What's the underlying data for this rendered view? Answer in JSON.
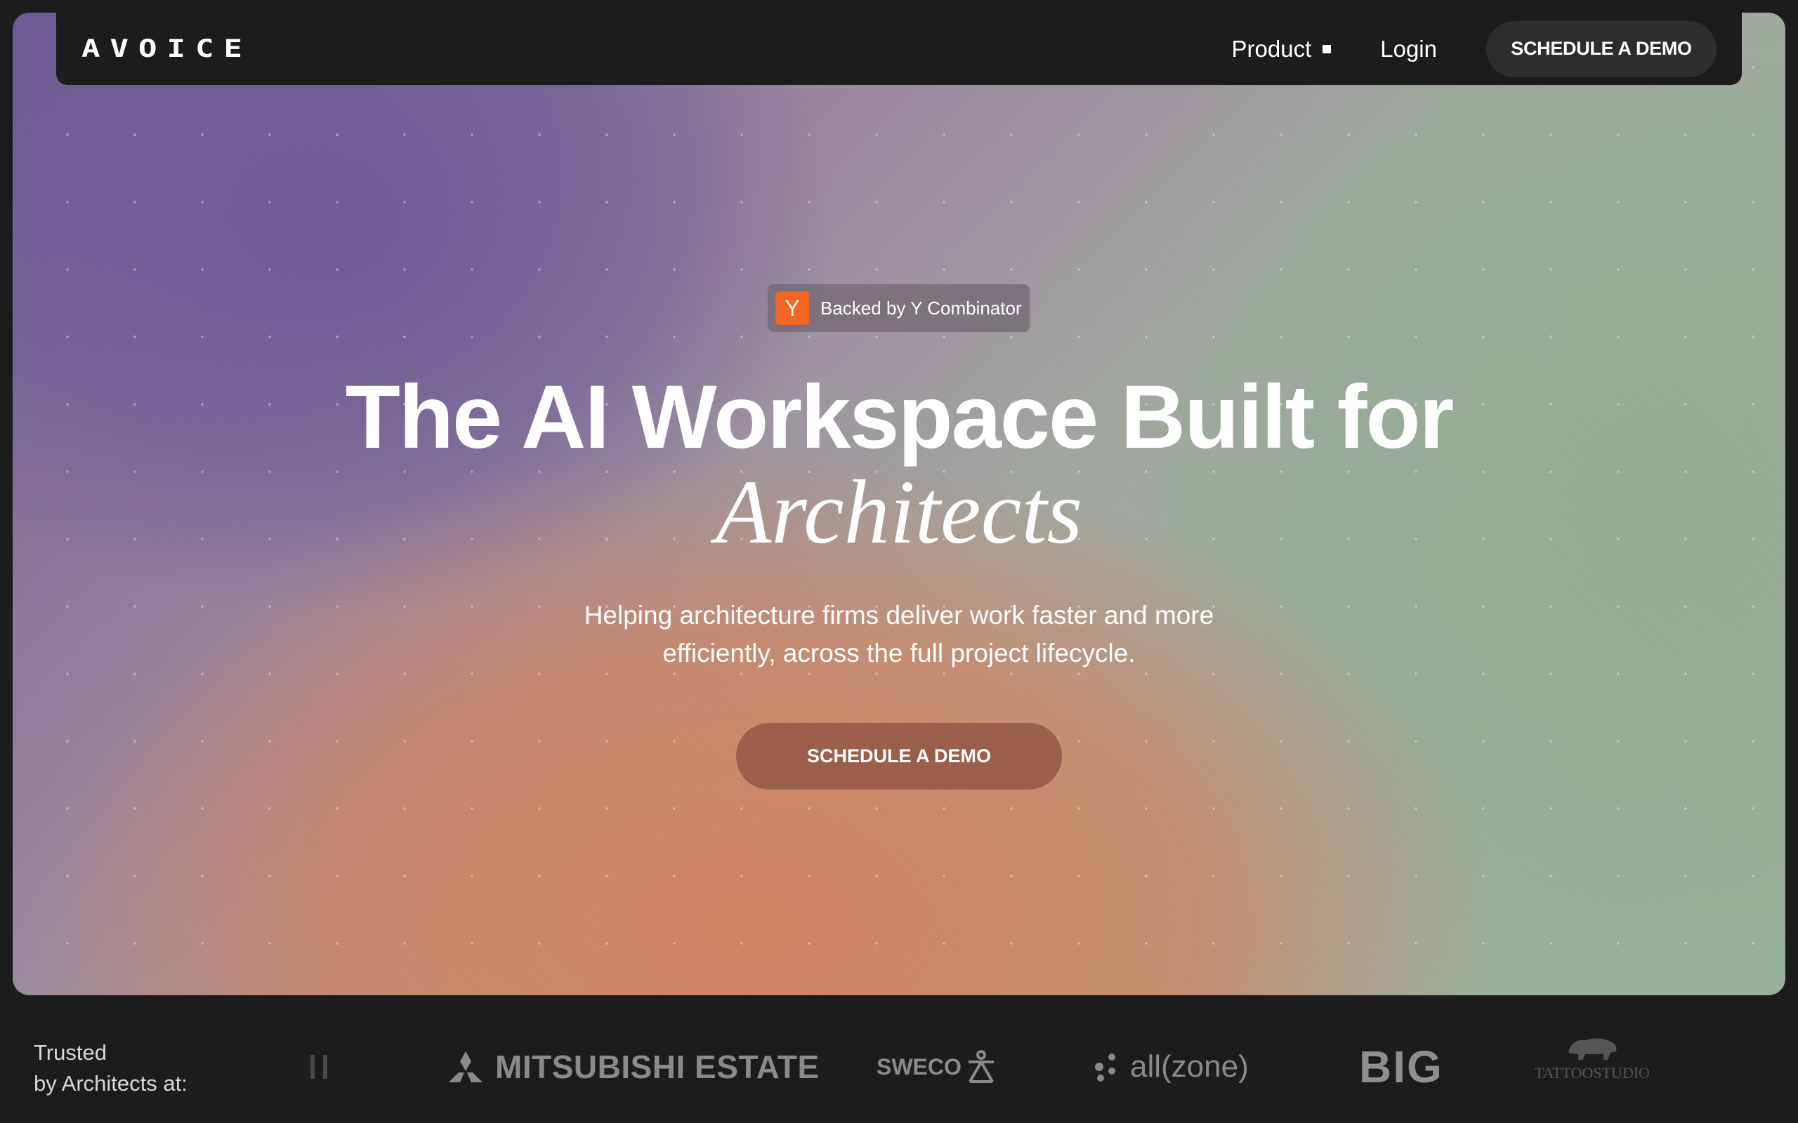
{
  "nav": {
    "logo": "AVOICE",
    "product_label": "Product",
    "login_label": "Login",
    "cta_label": "SCHEDULE A DEMO"
  },
  "hero": {
    "badge_letter": "Y",
    "badge_text": "Backed by Y Combinator",
    "headline": "The AI Workspace Built for",
    "headline_italic": "Architects",
    "subhead_line1": "Helping architecture firms deliver work faster and more",
    "subhead_line2": "efficiently, across the full project lifecycle.",
    "cta_label": "SCHEDULE A DEMO"
  },
  "trusted": {
    "line1": "Trusted",
    "line2": "by Architects at:",
    "logos": {
      "mitsubishi": "MITSUBISHI ESTATE",
      "sweco": "SWECO",
      "allzone": "all(zone)",
      "big": "BIG",
      "tattoo": "TATTOOSTUDIO"
    }
  },
  "colors": {
    "background": "#1c1c1c",
    "badge_icon": "#f26522",
    "hero_cta": "#965a48"
  }
}
